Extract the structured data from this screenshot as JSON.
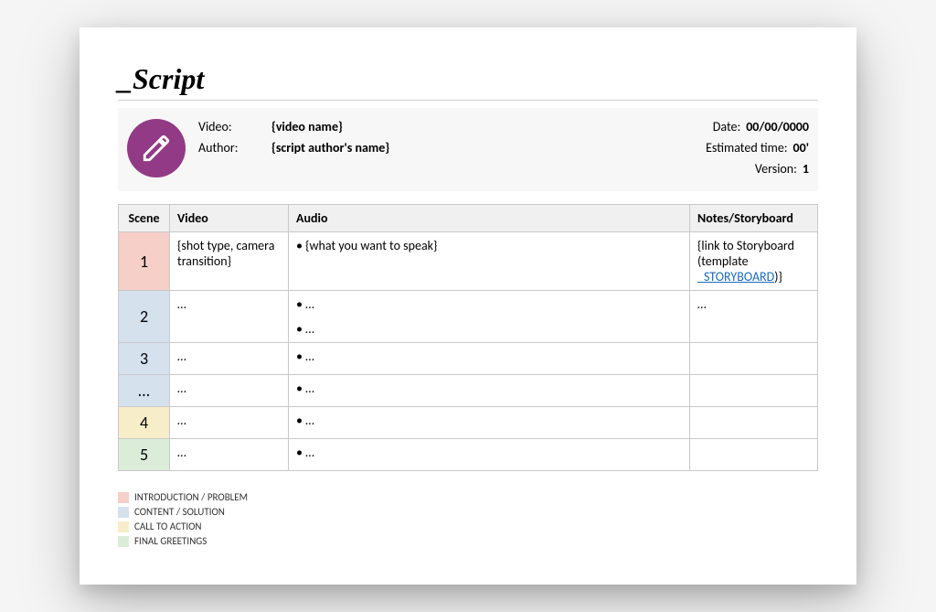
{
  "title": "_Script",
  "meta": {
    "video_label": "Video:",
    "video_value": "{video name}",
    "author_label": "Author:",
    "author_value": "{script author's name}",
    "date_label": "Date:",
    "date_value": "00/00/0000",
    "est_label": "Estimated time:",
    "est_value": "00'",
    "version_label": "Version:",
    "version_value": "1"
  },
  "columns": {
    "scene": "Scene",
    "video": "Video",
    "audio": "Audio",
    "notes": "Notes/Storyboard"
  },
  "rows": [
    {
      "scene": "1",
      "color": "c-intro",
      "video": "{shot type, camera transition}",
      "audio": [
        "{what you want to speak}"
      ],
      "notes_pre": "{link to Storyboard (template ",
      "notes_link": "_STORYBOARD",
      "notes_post": ")}"
    },
    {
      "scene": "2",
      "color": "c-content",
      "video": "…",
      "audio": [
        "…",
        "…"
      ],
      "notes_pre": "…",
      "notes_link": "",
      "notes_post": ""
    },
    {
      "scene": "3",
      "color": "c-content",
      "video": "…",
      "audio": [
        "…"
      ],
      "notes_pre": "",
      "notes_link": "",
      "notes_post": ""
    },
    {
      "scene": "…",
      "color": "c-content",
      "video": "…",
      "audio": [
        "…"
      ],
      "notes_pre": "",
      "notes_link": "",
      "notes_post": ""
    },
    {
      "scene": "4",
      "color": "c-cta",
      "video": "…",
      "audio": [
        "…"
      ],
      "notes_pre": "",
      "notes_link": "",
      "notes_post": ""
    },
    {
      "scene": "5",
      "color": "c-final",
      "video": "…",
      "audio": [
        "…"
      ],
      "notes_pre": "",
      "notes_link": "",
      "notes_post": ""
    }
  ],
  "legend": [
    {
      "color": "c-intro",
      "label": "INTRODUCTION / PROBLEM"
    },
    {
      "color": "c-content",
      "label": "CONTENT / SOLUTION"
    },
    {
      "color": "c-cta",
      "label": "CALL TO ACTION"
    },
    {
      "color": "c-final",
      "label": "FINAL GREETINGS"
    }
  ]
}
